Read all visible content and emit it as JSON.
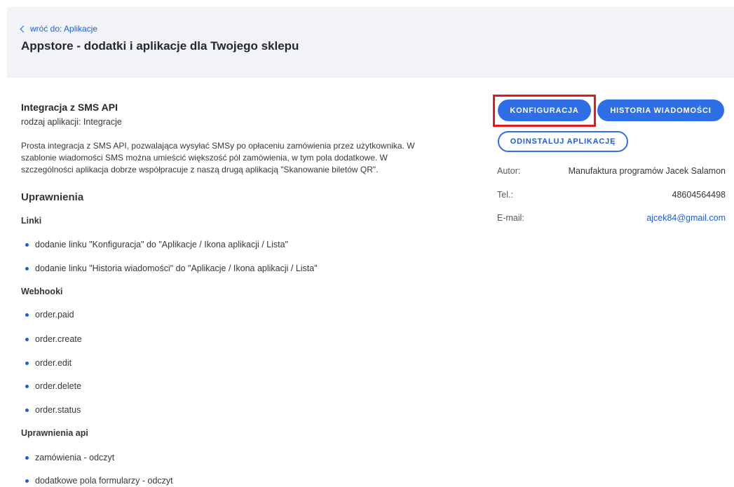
{
  "header": {
    "back_link": "wróć do: Aplikacje",
    "title": "Appstore - dodatki i aplikacje dla Twojego sklepu"
  },
  "app": {
    "name": "Integracja z SMS API",
    "type": "rodzaj aplikacji: Integracje",
    "description_lines": [
      "Prosta integracja z SMS API, pozwalająca wysyłać SMSy po opłaceniu zamówienia przez użytkownika. W",
      "szablonie wiadomości SMS można umieścić większość pól zamówienia, w tym pola dodatkowe. W",
      "szczególności aplikacja dobrze współpracuje z naszą drugą aplikacją \"Skanowanie biletów QR\"."
    ]
  },
  "permissions": {
    "heading": "Uprawnienia",
    "links": {
      "heading": "Linki",
      "items": [
        "dodanie linku \"Konfiguracja\" do \"Aplikacje / Ikona aplikacji / Lista\"",
        "dodanie linku \"Historia wiadomości\" do \"Aplikacje / Ikona aplikacji / Lista\""
      ]
    },
    "webhooks": {
      "heading": "Webhooki",
      "items": [
        "order.paid",
        "order.create",
        "order.edit",
        "order.delete",
        "order.status"
      ]
    },
    "api": {
      "heading": "Uprawnienia api",
      "items": [
        "zamówienia - odczyt",
        "dodatkowe pola formularzy - odczyt"
      ]
    }
  },
  "actions": {
    "configure": "KONFIGURACJA",
    "history": "HISTORIA WIADOMOŚCI",
    "uninstall": "ODINSTALUJ APLIKACJĘ"
  },
  "info": {
    "author_label": "Autor:",
    "author_value": "Manufaktura programów Jacek Salamon",
    "tel_label": "Tel.:",
    "tel_value": "48604564498",
    "email_label": "E-mail:",
    "email_value": "ajcek84@gmail.com"
  },
  "colors": {
    "accent": "#2f6fe6",
    "highlight": "#e3191e",
    "header_bg": "#f2f3f6"
  }
}
